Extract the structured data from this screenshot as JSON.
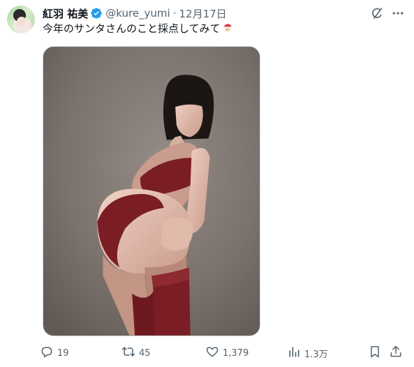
{
  "author": {
    "display_name": "紅羽 祐美",
    "handle": "@kure_yumi",
    "separator": "·",
    "date": "12月17日",
    "verified": true
  },
  "tweet": {
    "text": "今年のサンタさんのこと採点してみて",
    "emoji": "santa-emoji"
  },
  "media": {
    "type": "photo",
    "background_color": "#7b716c",
    "garment_color": "#7a1d24"
  },
  "actions": {
    "reply_count": "19",
    "retweet_count": "45",
    "like_count": "1,379",
    "view_count": "1.3万"
  },
  "colors": {
    "text": "#0f1419",
    "secondary": "#536471",
    "verified": "#1d9bf0",
    "border": "#cfd9de"
  },
  "icons": [
    "grok-icon",
    "more-icon",
    "reply-icon",
    "retweet-icon",
    "like-icon",
    "views-icon",
    "bookmark-icon",
    "share-icon",
    "verified-badge-icon"
  ]
}
